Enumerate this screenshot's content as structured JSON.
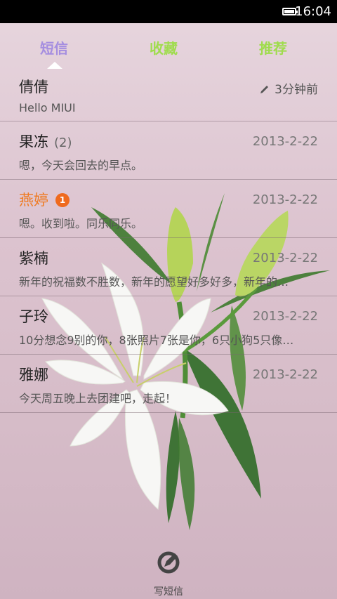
{
  "status_bar": {
    "time": "16:04"
  },
  "tabs": [
    {
      "label": "短信",
      "active": true
    },
    {
      "label": "收藏",
      "active": false
    },
    {
      "label": "推荐",
      "active": false
    }
  ],
  "conversations": [
    {
      "name": "倩倩",
      "count": "",
      "badge": "",
      "preview": "Hello MIUI",
      "date": "3分钟前",
      "draft": true
    },
    {
      "name": "果冻",
      "count": "(2)",
      "badge": "",
      "preview": "嗯，今天会回去的早点。",
      "date": "2013-2-22"
    },
    {
      "name": "燕婷",
      "count": "",
      "badge": "1",
      "preview": "嗯。收到啦。同乐同乐。",
      "date": "2013-2-22",
      "unread": true
    },
    {
      "name": "紫楠",
      "count": "",
      "badge": "",
      "preview": "新年的祝福数不胜数，新年的愿望好多好多，新年的…",
      "date": "2013-2-22"
    },
    {
      "name": "子玲",
      "count": "",
      "badge": "",
      "preview": "10分想念9别的你，8张照片7张是你，6只小狗5只像…",
      "date": "2013-2-22"
    },
    {
      "name": "雅娜",
      "count": "",
      "badge": "",
      "preview": "今天周五晚上去团建吧，走起！",
      "date": "2013-2-22"
    }
  ],
  "compose": {
    "label": "写短信"
  },
  "colors": {
    "accent_tab": "#a58ee0",
    "inactive_tab": "#9fdc4d",
    "unread": "#ef7a21",
    "badge": "#ef6a1e"
  }
}
